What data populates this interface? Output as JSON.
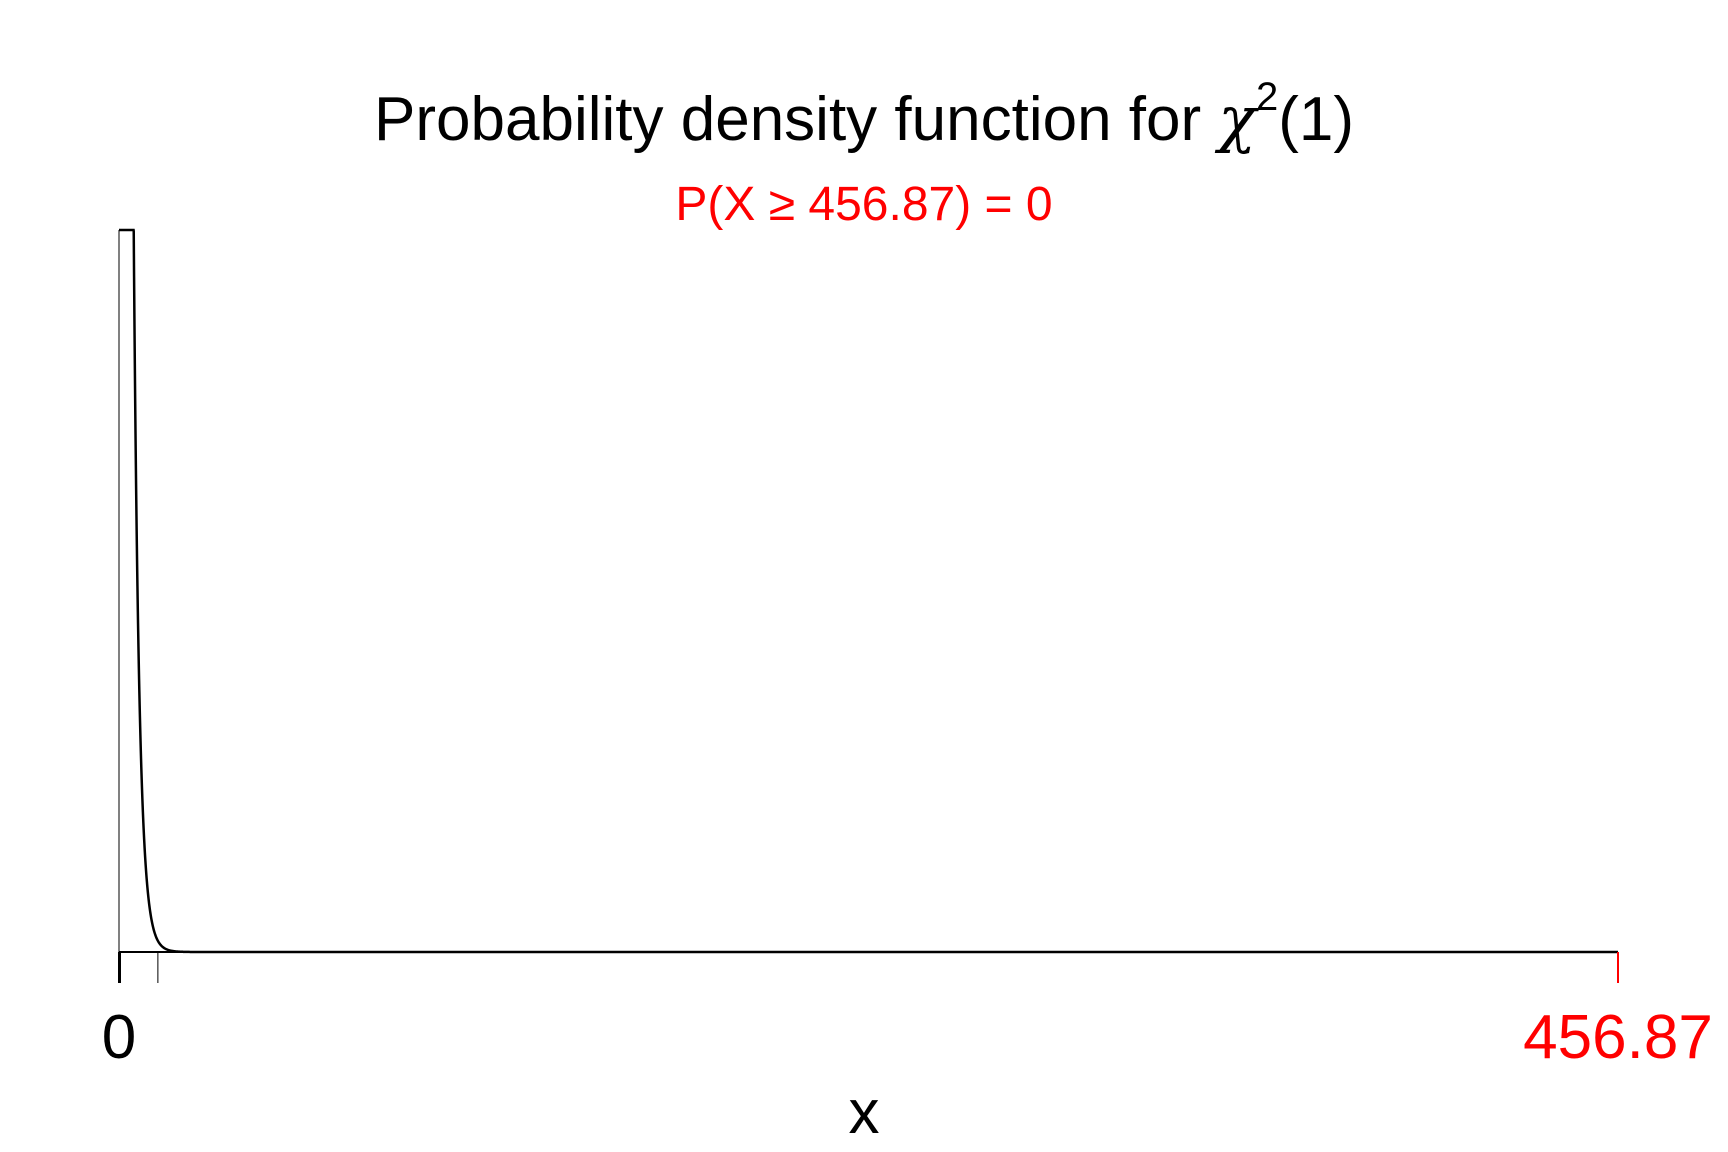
{
  "chart_data": {
    "type": "line",
    "title": {
      "prefix": "Probability density function for ",
      "symbol": "χ",
      "superscript": "2",
      "suffix": "(1)"
    },
    "subtitle": "P(X ≥ 456.87) = 0",
    "xlabel": "x",
    "ylabel": "",
    "xlim": [
      0,
      456.87
    ],
    "distribution": "chi-squared",
    "df": 1,
    "critical_value": 456.87,
    "tail_probability": 0,
    "x_tick_labels": [
      {
        "value": 0,
        "label": "0",
        "color": "#000000"
      },
      {
        "value": 456.87,
        "label": "456.87",
        "color": "#ff0000"
      }
    ],
    "minor_x_ticks": [
      0,
      0.455,
      11.85
    ],
    "series": [
      {
        "color": "#000000"
      }
    ],
    "grid": false,
    "legend": "none"
  },
  "colors": {
    "curve": "#000000",
    "axis": "#000000",
    "highlight": "#ff0000"
  }
}
